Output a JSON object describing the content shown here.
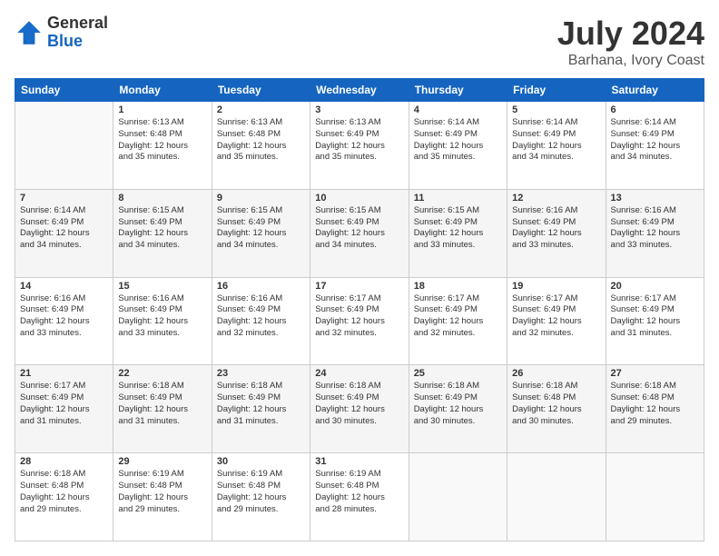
{
  "logo": {
    "general": "General",
    "blue": "Blue"
  },
  "title": "July 2024",
  "subtitle": "Barhana, Ivory Coast",
  "days_of_week": [
    "Sunday",
    "Monday",
    "Tuesday",
    "Wednesday",
    "Thursday",
    "Friday",
    "Saturday"
  ],
  "weeks": [
    [
      {
        "day": "",
        "info": ""
      },
      {
        "day": "1",
        "info": "Sunrise: 6:13 AM\nSunset: 6:48 PM\nDaylight: 12 hours\nand 35 minutes."
      },
      {
        "day": "2",
        "info": "Sunrise: 6:13 AM\nSunset: 6:48 PM\nDaylight: 12 hours\nand 35 minutes."
      },
      {
        "day": "3",
        "info": "Sunrise: 6:13 AM\nSunset: 6:49 PM\nDaylight: 12 hours\nand 35 minutes."
      },
      {
        "day": "4",
        "info": "Sunrise: 6:14 AM\nSunset: 6:49 PM\nDaylight: 12 hours\nand 35 minutes."
      },
      {
        "day": "5",
        "info": "Sunrise: 6:14 AM\nSunset: 6:49 PM\nDaylight: 12 hours\nand 34 minutes."
      },
      {
        "day": "6",
        "info": "Sunrise: 6:14 AM\nSunset: 6:49 PM\nDaylight: 12 hours\nand 34 minutes."
      }
    ],
    [
      {
        "day": "7",
        "info": "Sunrise: 6:14 AM\nSunset: 6:49 PM\nDaylight: 12 hours\nand 34 minutes."
      },
      {
        "day": "8",
        "info": "Sunrise: 6:15 AM\nSunset: 6:49 PM\nDaylight: 12 hours\nand 34 minutes."
      },
      {
        "day": "9",
        "info": "Sunrise: 6:15 AM\nSunset: 6:49 PM\nDaylight: 12 hours\nand 34 minutes."
      },
      {
        "day": "10",
        "info": "Sunrise: 6:15 AM\nSunset: 6:49 PM\nDaylight: 12 hours\nand 34 minutes."
      },
      {
        "day": "11",
        "info": "Sunrise: 6:15 AM\nSunset: 6:49 PM\nDaylight: 12 hours\nand 33 minutes."
      },
      {
        "day": "12",
        "info": "Sunrise: 6:16 AM\nSunset: 6:49 PM\nDaylight: 12 hours\nand 33 minutes."
      },
      {
        "day": "13",
        "info": "Sunrise: 6:16 AM\nSunset: 6:49 PM\nDaylight: 12 hours\nand 33 minutes."
      }
    ],
    [
      {
        "day": "14",
        "info": "Sunrise: 6:16 AM\nSunset: 6:49 PM\nDaylight: 12 hours\nand 33 minutes."
      },
      {
        "day": "15",
        "info": "Sunrise: 6:16 AM\nSunset: 6:49 PM\nDaylight: 12 hours\nand 33 minutes."
      },
      {
        "day": "16",
        "info": "Sunrise: 6:16 AM\nSunset: 6:49 PM\nDaylight: 12 hours\nand 32 minutes."
      },
      {
        "day": "17",
        "info": "Sunrise: 6:17 AM\nSunset: 6:49 PM\nDaylight: 12 hours\nand 32 minutes."
      },
      {
        "day": "18",
        "info": "Sunrise: 6:17 AM\nSunset: 6:49 PM\nDaylight: 12 hours\nand 32 minutes."
      },
      {
        "day": "19",
        "info": "Sunrise: 6:17 AM\nSunset: 6:49 PM\nDaylight: 12 hours\nand 32 minutes."
      },
      {
        "day": "20",
        "info": "Sunrise: 6:17 AM\nSunset: 6:49 PM\nDaylight: 12 hours\nand 31 minutes."
      }
    ],
    [
      {
        "day": "21",
        "info": "Sunrise: 6:17 AM\nSunset: 6:49 PM\nDaylight: 12 hours\nand 31 minutes."
      },
      {
        "day": "22",
        "info": "Sunrise: 6:18 AM\nSunset: 6:49 PM\nDaylight: 12 hours\nand 31 minutes."
      },
      {
        "day": "23",
        "info": "Sunrise: 6:18 AM\nSunset: 6:49 PM\nDaylight: 12 hours\nand 31 minutes."
      },
      {
        "day": "24",
        "info": "Sunrise: 6:18 AM\nSunset: 6:49 PM\nDaylight: 12 hours\nand 30 minutes."
      },
      {
        "day": "25",
        "info": "Sunrise: 6:18 AM\nSunset: 6:49 PM\nDaylight: 12 hours\nand 30 minutes."
      },
      {
        "day": "26",
        "info": "Sunrise: 6:18 AM\nSunset: 6:48 PM\nDaylight: 12 hours\nand 30 minutes."
      },
      {
        "day": "27",
        "info": "Sunrise: 6:18 AM\nSunset: 6:48 PM\nDaylight: 12 hours\nand 29 minutes."
      }
    ],
    [
      {
        "day": "28",
        "info": "Sunrise: 6:18 AM\nSunset: 6:48 PM\nDaylight: 12 hours\nand 29 minutes."
      },
      {
        "day": "29",
        "info": "Sunrise: 6:19 AM\nSunset: 6:48 PM\nDaylight: 12 hours\nand 29 minutes."
      },
      {
        "day": "30",
        "info": "Sunrise: 6:19 AM\nSunset: 6:48 PM\nDaylight: 12 hours\nand 29 minutes."
      },
      {
        "day": "31",
        "info": "Sunrise: 6:19 AM\nSunset: 6:48 PM\nDaylight: 12 hours\nand 28 minutes."
      },
      {
        "day": "",
        "info": ""
      },
      {
        "day": "",
        "info": ""
      },
      {
        "day": "",
        "info": ""
      }
    ]
  ]
}
